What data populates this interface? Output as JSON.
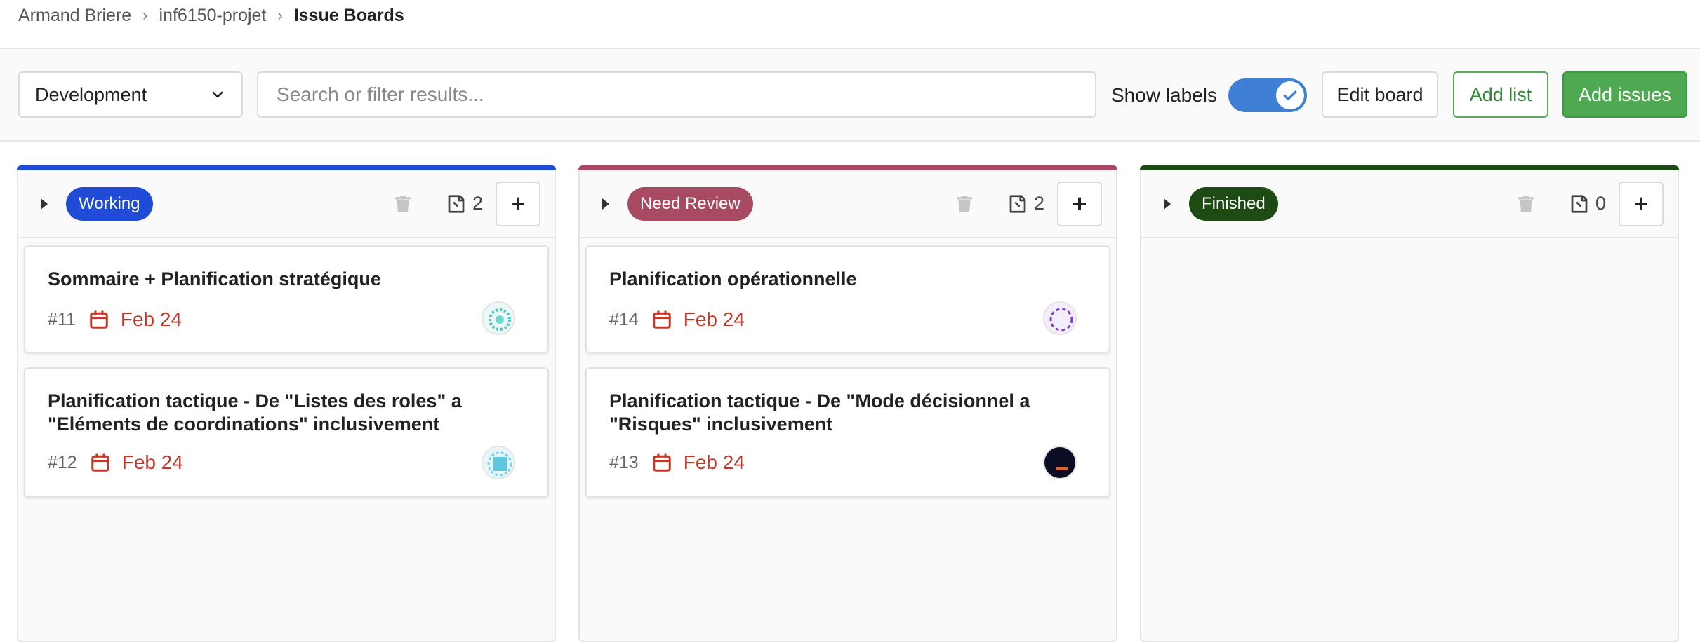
{
  "breadcrumb": {
    "items": [
      "Armand Briere",
      "inf6150-projet",
      "Issue Boards"
    ]
  },
  "filter": {
    "board": "Development",
    "search_placeholder": "Search or filter results...",
    "show_labels": "Show labels",
    "show_labels_on": true,
    "edit_board": "Edit board",
    "add_list": "Add list",
    "add_issues": "Add issues"
  },
  "colors": {
    "working": "#1f4bd6",
    "need_review": "#a84a62",
    "finished": "#1e4a14",
    "due": "#c0392b",
    "primary": "#4fa852",
    "toggle": "#3f7fd6"
  },
  "lists": [
    {
      "label": "Working",
      "count": "2",
      "cards": [
        {
          "title": "Sommaire + Planification stratégique",
          "number": "#11",
          "due": "Feb 24"
        },
        {
          "title": "Planification tactique - De \"Listes des roles\" a \"Eléments de coordinations\" inclusivement",
          "number": "#12",
          "due": "Feb 24"
        }
      ]
    },
    {
      "label": "Need Review",
      "count": "2",
      "cards": [
        {
          "title": "Planification opérationnelle",
          "number": "#14",
          "due": "Feb 24"
        },
        {
          "title": "Planification tactique - De \"Mode décisionnel a \"Risques\" inclusivement",
          "number": "#13",
          "due": "Feb 24"
        }
      ]
    },
    {
      "label": "Finished",
      "count": "0",
      "cards": []
    }
  ]
}
